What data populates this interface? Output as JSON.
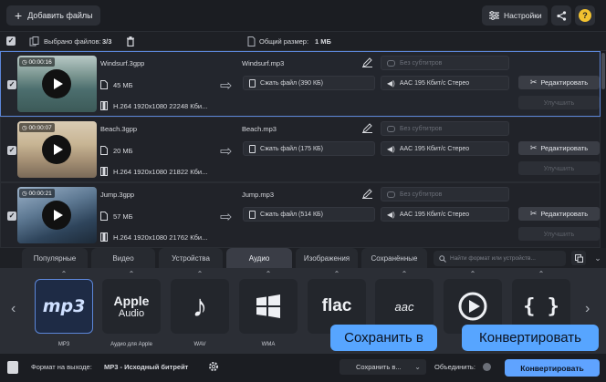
{
  "colors": {
    "accent": "#5c86d8",
    "callout": "#57a5ff",
    "convert_button": "#5fa3ff"
  },
  "toolbar": {
    "add_files": "Добавить файлы",
    "settings": "Настройки",
    "help": "?"
  },
  "selection": {
    "selected_label": "Выбрано файлов:",
    "selected_count": "3/3",
    "total_size_label": "Общий размер:",
    "total_size": "1 МБ"
  },
  "files": [
    {
      "duration": "00:00:16",
      "name": "Windsurf.3gpp",
      "size": "45 МБ",
      "video_info": "H.264 1920x1080 22248 Кби...",
      "output_name": "Windsurf.mp3",
      "compress": "Сжать файл (390 КБ)",
      "subtitles": "Без субтитров",
      "audio": "AAC 195 Кбит/с Стерео",
      "edit": "Редактировать",
      "enhance": "Улучшить"
    },
    {
      "duration": "00:00:07",
      "name": "Beach.3gpp",
      "size": "20 МБ",
      "video_info": "H.264 1920x1080 21822 Кби...",
      "output_name": "Beach.mp3",
      "compress": "Сжать файл (175 КБ)",
      "subtitles": "Без субтитров",
      "audio": "AAC 195 Кбит/с Стерео",
      "edit": "Редактировать",
      "enhance": "Улучшить"
    },
    {
      "duration": "00:00:21",
      "name": "Jump.3gpp",
      "size": "57 МБ",
      "video_info": "H.264 1920x1080 21762 Кби...",
      "output_name": "Jump.mp3",
      "compress": "Сжать файл (514 КБ)",
      "subtitles": "Без субтитров",
      "audio": "AAC 195 Кбит/с Стерео",
      "edit": "Редактировать",
      "enhance": "Улучшить"
    }
  ],
  "tabs": [
    "Популярные",
    "Видео",
    "Устройства",
    "Аудио",
    "Изображения",
    "Сохранённые"
  ],
  "active_tab": "Аудио",
  "search_placeholder": "Найти формат или устройств...",
  "formats": [
    {
      "label": "MP3",
      "logo": "mp3",
      "icon": "mp3-logo-icon"
    },
    {
      "label": "Аудио для Apple",
      "logo_top": "Apple",
      "logo_bottom": "Audio",
      "icon": "apple-audio-icon"
    },
    {
      "label": "WAV",
      "icon": "music-note-icon"
    },
    {
      "label": "WMA",
      "icon": "windows-logo-icon"
    },
    {
      "label": "",
      "logo": "flac",
      "icon": "flac-logo-icon"
    },
    {
      "label": "",
      "logo": "aac",
      "icon": "aac-logo-icon"
    },
    {
      "label": "",
      "icon": "play-circle-icon"
    },
    {
      "label": "",
      "logo": "{ }",
      "icon": "braces-icon"
    }
  ],
  "bottom": {
    "output_format_label": "Формат на выходе:",
    "output_format_value": "MP3 - Исходный битрейт",
    "save_to": "Сохранить в...",
    "merge_label": "Объединить:",
    "convert": "Конвертировать"
  },
  "callouts": {
    "save_to": "Сохранить в",
    "convert": "Конвертировать"
  }
}
